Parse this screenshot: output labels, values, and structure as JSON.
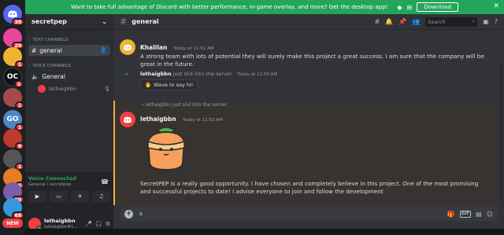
{
  "banner": {
    "text": "Want to take full advantage of Discord with better performance, in-game overlay, and more? Get the desktop app!",
    "download_label": "Download",
    "close_glyph": "✕"
  },
  "servers": [
    {
      "initials": "",
      "color": "#5865f2",
      "badge": "39"
    },
    {
      "initials": "",
      "color": "#eb459e",
      "badge": "29"
    },
    {
      "initials": "",
      "color": "#f0b232",
      "badge": "1"
    },
    {
      "initials": "OC",
      "color": "#111214",
      "badge": "1"
    },
    {
      "initials": "",
      "color": "#a34b4b",
      "badge": "1"
    },
    {
      "initials": "GO",
      "color": "#4e86c6",
      "badge": "1"
    },
    {
      "initials": "",
      "color": "#c0392b",
      "badge": "9"
    },
    {
      "initials": "",
      "color": "#555555",
      "badge": "1"
    },
    {
      "initials": "",
      "color": "#e67e22",
      "badge": "5"
    },
    {
      "initials": "",
      "color": "#7b5ea7",
      "badge": "10"
    },
    {
      "initials": "",
      "color": "#3498db",
      "badge": "68"
    }
  ],
  "new_badge": "NEW",
  "sidebar": {
    "guild_name": "secretpep",
    "text_channels_label": "TEXT CHANNELS",
    "text_channel": "general",
    "voice_channels_label": "VOICE CHANNELS",
    "voice_channel": "General",
    "voice_user": "lethaigbbn"
  },
  "voice": {
    "status": "Voice Connected",
    "location": "General / secretpep"
  },
  "user": {
    "name": "lethaigbbn",
    "tag": "lethaigbbn#1..."
  },
  "topbar": {
    "channel": "general",
    "search_placeholder": "Search"
  },
  "messages": {
    "m1": {
      "author": "Khalilan",
      "time": "Today at 11:51 AM",
      "text": "A strong team with lots of potential they will surely make this project a great success. I am sure that the company will be great in the future."
    },
    "join1": {
      "user": "lethaigbbn",
      "text": "just slid into the server.",
      "time": "Today at 11:53 AM",
      "wave_label": "Wave to say hi!"
    },
    "reply": {
      "text": "lethaigbbn just slid into the server."
    },
    "m2": {
      "author": "lethaigbbn",
      "time": "Today at 11:53 AM",
      "text": "SecretPEP is a really good opportunity. I have chosen and completely believe in this project. One of the most promising and successful projects to date! I advise everyone to join and follow the development"
    }
  },
  "composer": {
    "value": "s",
    "gif_label": "GIF"
  },
  "colors": {
    "accent_green": "#23a55a",
    "mention_yellow": "#f0b232",
    "discord_red": "#f23f43"
  }
}
